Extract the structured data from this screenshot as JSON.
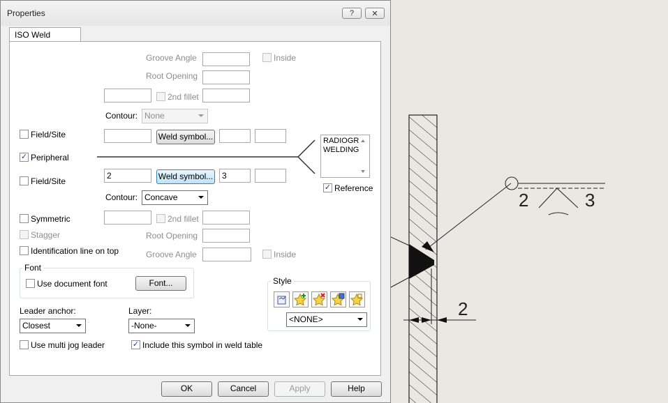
{
  "window": {
    "title": "Properties",
    "help_glyph": "?",
    "close_glyph": "✕"
  },
  "tab": {
    "label": "ISO Weld Symbol"
  },
  "top": {
    "groove_angle_label": "Groove Angle",
    "root_opening_label": "Root Opening",
    "inside_label": "Inside",
    "second_fillet_label": "2nd fillet",
    "contour_label": "Contour:",
    "contour_value": "None"
  },
  "arrow_side": {
    "field_site_label": "Field/Site",
    "weld_symbol_label": "Weld symbol...",
    "size_value": "",
    "length_value": ""
  },
  "peripheral": {
    "label": "Peripheral",
    "checked": true
  },
  "other_side": {
    "field_site_label": "Field/Site",
    "weld_symbol_label": "Weld symbol...",
    "size_value": "2",
    "length_value": "3",
    "contour_label": "Contour:",
    "contour_value": "Concave"
  },
  "notes": {
    "line1": "RADIOGR",
    "line2": "WELDING",
    "reference_label": "Reference",
    "reference_checked": true
  },
  "options": {
    "symmetric_label": "Symmetric",
    "second_fillet_label": "2nd fillet",
    "stagger_label": "Stagger",
    "root_opening_label": "Root Opening",
    "id_line_label": "Identification line on top",
    "groove_angle_label": "Groove Angle",
    "inside_label": "Inside"
  },
  "font": {
    "group_label": "Font",
    "use_document_font_label": "Use document font",
    "font_button_label": "Font..."
  },
  "style": {
    "group_label": "Style",
    "select_value": "<NONE>"
  },
  "leader": {
    "label": "Leader anchor:",
    "value": "Closest"
  },
  "layer": {
    "label": "Layer:",
    "value": "-None-"
  },
  "bottom": {
    "multi_jog_label": "Use multi jog leader",
    "include_table_label": "Include this symbol in weld table",
    "include_checked": true
  },
  "footer": {
    "ok_label": "OK",
    "cancel_label": "Cancel",
    "apply_label": "Apply",
    "help_label": "Help"
  },
  "drawing": {
    "left_number": "2",
    "right_number": "3",
    "dimension_value": "2"
  }
}
